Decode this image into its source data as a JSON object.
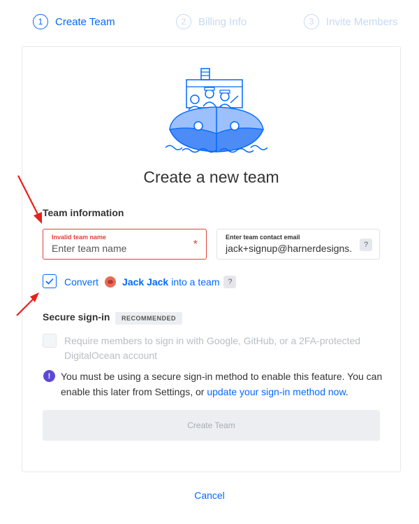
{
  "stepper": {
    "steps": [
      {
        "num": "1",
        "label": "Create Team"
      },
      {
        "num": "2",
        "label": "Billing Info"
      },
      {
        "num": "3",
        "label": "Invite Members"
      }
    ]
  },
  "page_title": "Create a new team",
  "team_info": {
    "section_label": "Team information",
    "name_field": {
      "label": "Invalid team name",
      "placeholder": "Enter team name",
      "required_marker": "*"
    },
    "email_field": {
      "label": "Enter team contact email",
      "value": "jack+signup@harnerdesigns.",
      "help": "?"
    }
  },
  "convert": {
    "prefix": "Convert",
    "user_name": "Jack Jack",
    "suffix": "into a team",
    "help": "?"
  },
  "secure_signin": {
    "section_label": "Secure sign-in",
    "badge": "RECOMMENDED",
    "option_text": "Require members to sign in with Google, GitHub, or a 2FA-protected DigitalOcean account",
    "info_icon": "!",
    "info_text": "You must be using a secure sign-in method to enable this feature. You can enable this later from Settings, or",
    "info_link": "update your sign-in method now",
    "info_end": "."
  },
  "create_button": "Create Team",
  "cancel_link": "Cancel",
  "colors": {
    "accent": "#0069ff",
    "error": "#e0403a",
    "info": "#5b49d6"
  }
}
